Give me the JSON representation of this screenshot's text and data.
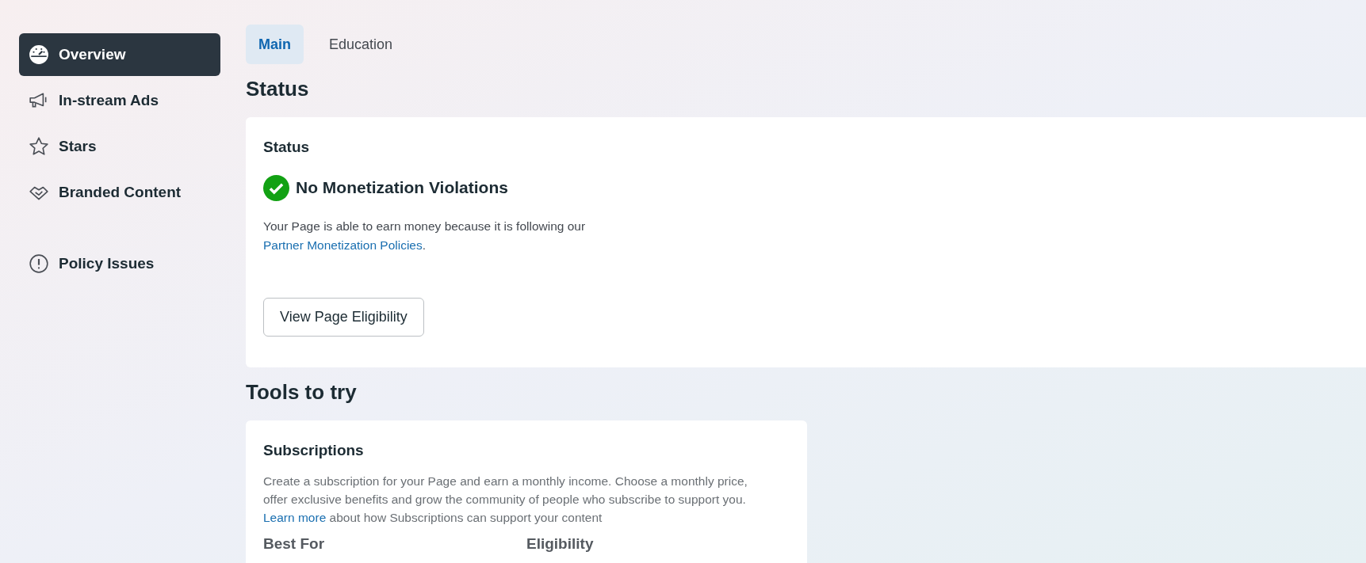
{
  "sidebar": {
    "items": [
      {
        "label": "Overview",
        "selected": true
      },
      {
        "label": "In-stream Ads",
        "selected": false
      },
      {
        "label": "Stars",
        "selected": false
      },
      {
        "label": "Branded Content",
        "selected": false
      },
      {
        "label": "Policy Issues",
        "selected": false
      }
    ]
  },
  "tabs": [
    {
      "label": "Main",
      "selected": true
    },
    {
      "label": "Education",
      "selected": false
    }
  ],
  "status_section": {
    "heading": "Status",
    "card": {
      "title": "Status",
      "status": {
        "kind": "ok",
        "label": "No Monetization Violations"
      },
      "description": {
        "before": "Your Page is able to earn money because it is following our",
        "link": "Partner Monetization Policies",
        "after": "."
      },
      "button": "View Page Eligibility"
    }
  },
  "tools_section": {
    "heading": "Tools to try",
    "card": {
      "title": "Subscriptions",
      "description": {
        "before": "Create a subscription for your Page and earn a monthly income. Choose a monthly price, offer exclusive benefits and grow the community of people who subscribe to support you.",
        "link": "Learn more",
        "after": "about how Subscriptions can support your content"
      },
      "columns": [
        "Best For",
        "Eligibility"
      ]
    }
  }
}
